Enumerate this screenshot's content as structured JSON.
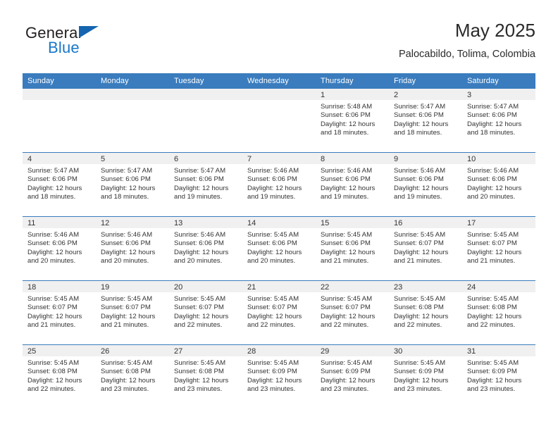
{
  "brand": {
    "name_part1": "General",
    "name_part2": "Blue",
    "flag_icon": "triangle-flag-icon"
  },
  "header": {
    "title": "May 2025",
    "subtitle": "Palocabildo, Tolima, Colombia"
  },
  "colors": {
    "header_blue": "#3a7cbe",
    "brand_blue": "#1877c9",
    "daynum_band": "#f0f0f0",
    "text": "#333333"
  },
  "weekdays": [
    "Sunday",
    "Monday",
    "Tuesday",
    "Wednesday",
    "Thursday",
    "Friday",
    "Saturday"
  ],
  "weeks": [
    [
      {
        "day": "",
        "sunrise": "",
        "sunset": "",
        "daylight_line1": "",
        "daylight_line2": ""
      },
      {
        "day": "",
        "sunrise": "",
        "sunset": "",
        "daylight_line1": "",
        "daylight_line2": ""
      },
      {
        "day": "",
        "sunrise": "",
        "sunset": "",
        "daylight_line1": "",
        "daylight_line2": ""
      },
      {
        "day": "",
        "sunrise": "",
        "sunset": "",
        "daylight_line1": "",
        "daylight_line2": ""
      },
      {
        "day": "1",
        "sunrise": "Sunrise: 5:48 AM",
        "sunset": "Sunset: 6:06 PM",
        "daylight_line1": "Daylight: 12 hours",
        "daylight_line2": "and 18 minutes."
      },
      {
        "day": "2",
        "sunrise": "Sunrise: 5:47 AM",
        "sunset": "Sunset: 6:06 PM",
        "daylight_line1": "Daylight: 12 hours",
        "daylight_line2": "and 18 minutes."
      },
      {
        "day": "3",
        "sunrise": "Sunrise: 5:47 AM",
        "sunset": "Sunset: 6:06 PM",
        "daylight_line1": "Daylight: 12 hours",
        "daylight_line2": "and 18 minutes."
      }
    ],
    [
      {
        "day": "4",
        "sunrise": "Sunrise: 5:47 AM",
        "sunset": "Sunset: 6:06 PM",
        "daylight_line1": "Daylight: 12 hours",
        "daylight_line2": "and 18 minutes."
      },
      {
        "day": "5",
        "sunrise": "Sunrise: 5:47 AM",
        "sunset": "Sunset: 6:06 PM",
        "daylight_line1": "Daylight: 12 hours",
        "daylight_line2": "and 18 minutes."
      },
      {
        "day": "6",
        "sunrise": "Sunrise: 5:47 AM",
        "sunset": "Sunset: 6:06 PM",
        "daylight_line1": "Daylight: 12 hours",
        "daylight_line2": "and 19 minutes."
      },
      {
        "day": "7",
        "sunrise": "Sunrise: 5:46 AM",
        "sunset": "Sunset: 6:06 PM",
        "daylight_line1": "Daylight: 12 hours",
        "daylight_line2": "and 19 minutes."
      },
      {
        "day": "8",
        "sunrise": "Sunrise: 5:46 AM",
        "sunset": "Sunset: 6:06 PM",
        "daylight_line1": "Daylight: 12 hours",
        "daylight_line2": "and 19 minutes."
      },
      {
        "day": "9",
        "sunrise": "Sunrise: 5:46 AM",
        "sunset": "Sunset: 6:06 PM",
        "daylight_line1": "Daylight: 12 hours",
        "daylight_line2": "and 19 minutes."
      },
      {
        "day": "10",
        "sunrise": "Sunrise: 5:46 AM",
        "sunset": "Sunset: 6:06 PM",
        "daylight_line1": "Daylight: 12 hours",
        "daylight_line2": "and 20 minutes."
      }
    ],
    [
      {
        "day": "11",
        "sunrise": "Sunrise: 5:46 AM",
        "sunset": "Sunset: 6:06 PM",
        "daylight_line1": "Daylight: 12 hours",
        "daylight_line2": "and 20 minutes."
      },
      {
        "day": "12",
        "sunrise": "Sunrise: 5:46 AM",
        "sunset": "Sunset: 6:06 PM",
        "daylight_line1": "Daylight: 12 hours",
        "daylight_line2": "and 20 minutes."
      },
      {
        "day": "13",
        "sunrise": "Sunrise: 5:46 AM",
        "sunset": "Sunset: 6:06 PM",
        "daylight_line1": "Daylight: 12 hours",
        "daylight_line2": "and 20 minutes."
      },
      {
        "day": "14",
        "sunrise": "Sunrise: 5:45 AM",
        "sunset": "Sunset: 6:06 PM",
        "daylight_line1": "Daylight: 12 hours",
        "daylight_line2": "and 20 minutes."
      },
      {
        "day": "15",
        "sunrise": "Sunrise: 5:45 AM",
        "sunset": "Sunset: 6:06 PM",
        "daylight_line1": "Daylight: 12 hours",
        "daylight_line2": "and 21 minutes."
      },
      {
        "day": "16",
        "sunrise": "Sunrise: 5:45 AM",
        "sunset": "Sunset: 6:07 PM",
        "daylight_line1": "Daylight: 12 hours",
        "daylight_line2": "and 21 minutes."
      },
      {
        "day": "17",
        "sunrise": "Sunrise: 5:45 AM",
        "sunset": "Sunset: 6:07 PM",
        "daylight_line1": "Daylight: 12 hours",
        "daylight_line2": "and 21 minutes."
      }
    ],
    [
      {
        "day": "18",
        "sunrise": "Sunrise: 5:45 AM",
        "sunset": "Sunset: 6:07 PM",
        "daylight_line1": "Daylight: 12 hours",
        "daylight_line2": "and 21 minutes."
      },
      {
        "day": "19",
        "sunrise": "Sunrise: 5:45 AM",
        "sunset": "Sunset: 6:07 PM",
        "daylight_line1": "Daylight: 12 hours",
        "daylight_line2": "and 21 minutes."
      },
      {
        "day": "20",
        "sunrise": "Sunrise: 5:45 AM",
        "sunset": "Sunset: 6:07 PM",
        "daylight_line1": "Daylight: 12 hours",
        "daylight_line2": "and 22 minutes."
      },
      {
        "day": "21",
        "sunrise": "Sunrise: 5:45 AM",
        "sunset": "Sunset: 6:07 PM",
        "daylight_line1": "Daylight: 12 hours",
        "daylight_line2": "and 22 minutes."
      },
      {
        "day": "22",
        "sunrise": "Sunrise: 5:45 AM",
        "sunset": "Sunset: 6:07 PM",
        "daylight_line1": "Daylight: 12 hours",
        "daylight_line2": "and 22 minutes."
      },
      {
        "day": "23",
        "sunrise": "Sunrise: 5:45 AM",
        "sunset": "Sunset: 6:08 PM",
        "daylight_line1": "Daylight: 12 hours",
        "daylight_line2": "and 22 minutes."
      },
      {
        "day": "24",
        "sunrise": "Sunrise: 5:45 AM",
        "sunset": "Sunset: 6:08 PM",
        "daylight_line1": "Daylight: 12 hours",
        "daylight_line2": "and 22 minutes."
      }
    ],
    [
      {
        "day": "25",
        "sunrise": "Sunrise: 5:45 AM",
        "sunset": "Sunset: 6:08 PM",
        "daylight_line1": "Daylight: 12 hours",
        "daylight_line2": "and 22 minutes."
      },
      {
        "day": "26",
        "sunrise": "Sunrise: 5:45 AM",
        "sunset": "Sunset: 6:08 PM",
        "daylight_line1": "Daylight: 12 hours",
        "daylight_line2": "and 23 minutes."
      },
      {
        "day": "27",
        "sunrise": "Sunrise: 5:45 AM",
        "sunset": "Sunset: 6:08 PM",
        "daylight_line1": "Daylight: 12 hours",
        "daylight_line2": "and 23 minutes."
      },
      {
        "day": "28",
        "sunrise": "Sunrise: 5:45 AM",
        "sunset": "Sunset: 6:09 PM",
        "daylight_line1": "Daylight: 12 hours",
        "daylight_line2": "and 23 minutes."
      },
      {
        "day": "29",
        "sunrise": "Sunrise: 5:45 AM",
        "sunset": "Sunset: 6:09 PM",
        "daylight_line1": "Daylight: 12 hours",
        "daylight_line2": "and 23 minutes."
      },
      {
        "day": "30",
        "sunrise": "Sunrise: 5:45 AM",
        "sunset": "Sunset: 6:09 PM",
        "daylight_line1": "Daylight: 12 hours",
        "daylight_line2": "and 23 minutes."
      },
      {
        "day": "31",
        "sunrise": "Sunrise: 5:45 AM",
        "sunset": "Sunset: 6:09 PM",
        "daylight_line1": "Daylight: 12 hours",
        "daylight_line2": "and 23 minutes."
      }
    ]
  ]
}
